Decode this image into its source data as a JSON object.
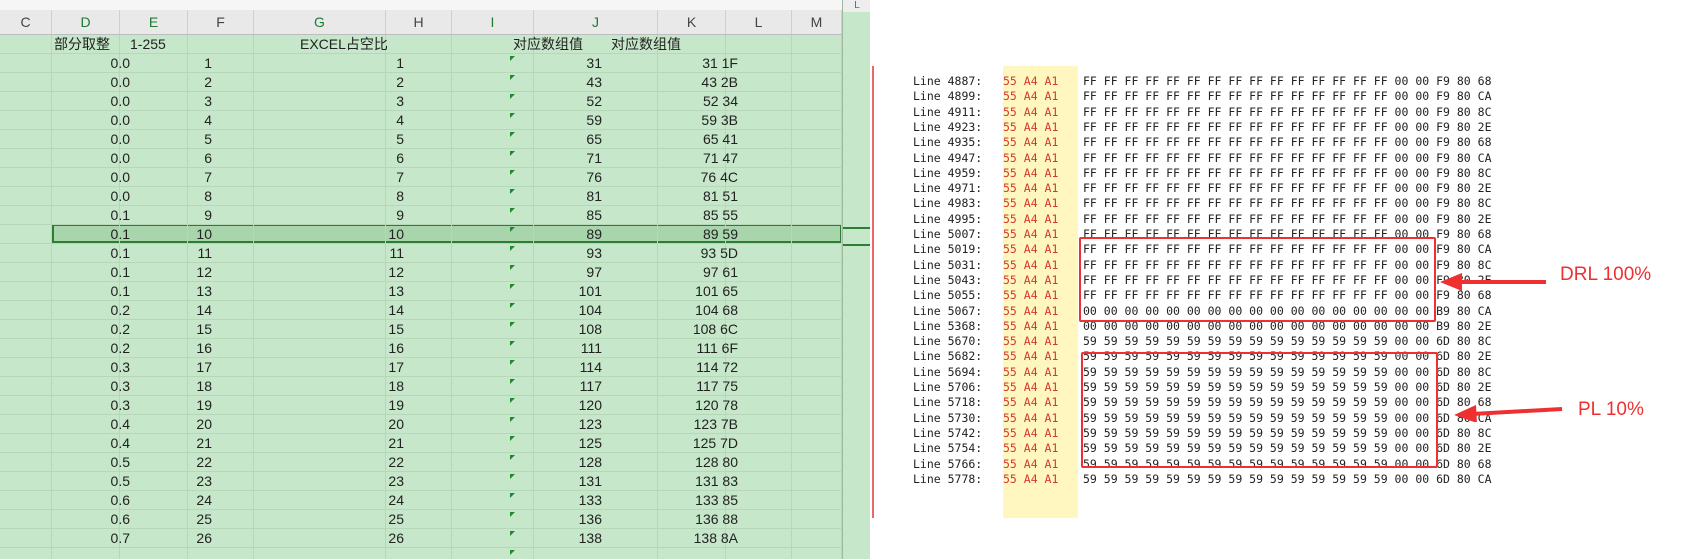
{
  "spreadsheet": {
    "column_headers": [
      "C",
      "D",
      "E",
      "F",
      "G",
      "H",
      "I",
      "J",
      "K",
      "L",
      "M"
    ],
    "side_header": "L",
    "headers": {
      "D": "部分取整",
      "E": "1-255",
      "G": "EXCEL占空比",
      "I": "对应数组值",
      "J": "对应数组值"
    },
    "rows": [
      {
        "d": "0.0",
        "e": "1",
        "g": "1",
        "i": "31",
        "j": "31 1F"
      },
      {
        "d": "0.0",
        "e": "2",
        "g": "2",
        "i": "43",
        "j": "43 2B"
      },
      {
        "d": "0.0",
        "e": "3",
        "g": "3",
        "i": "52",
        "j": "52 34"
      },
      {
        "d": "0.0",
        "e": "4",
        "g": "4",
        "i": "59",
        "j": "59 3B"
      },
      {
        "d": "0.0",
        "e": "5",
        "g": "5",
        "i": "65",
        "j": "65 41"
      },
      {
        "d": "0.0",
        "e": "6",
        "g": "6",
        "i": "71",
        "j": "71 47"
      },
      {
        "d": "0.0",
        "e": "7",
        "g": "7",
        "i": "76",
        "j": "76 4C"
      },
      {
        "d": "0.0",
        "e": "8",
        "g": "8",
        "i": "81",
        "j": "81 51"
      },
      {
        "d": "0.1",
        "e": "9",
        "g": "9",
        "i": "85",
        "j": "85 55"
      },
      {
        "d": "0.1",
        "e": "10",
        "g": "10",
        "i": "89",
        "j": "89 59"
      },
      {
        "d": "0.1",
        "e": "11",
        "g": "11",
        "i": "93",
        "j": "93 5D"
      },
      {
        "d": "0.1",
        "e": "12",
        "g": "12",
        "i": "97",
        "j": "97 61"
      },
      {
        "d": "0.1",
        "e": "13",
        "g": "13",
        "i": "101",
        "j": "101 65"
      },
      {
        "d": "0.2",
        "e": "14",
        "g": "14",
        "i": "104",
        "j": "104 68"
      },
      {
        "d": "0.2",
        "e": "15",
        "g": "15",
        "i": "108",
        "j": "108 6C"
      },
      {
        "d": "0.2",
        "e": "16",
        "g": "16",
        "i": "111",
        "j": "111 6F"
      },
      {
        "d": "0.3",
        "e": "17",
        "g": "17",
        "i": "114",
        "j": "114 72"
      },
      {
        "d": "0.3",
        "e": "18",
        "g": "18",
        "i": "117",
        "j": "117 75"
      },
      {
        "d": "0.3",
        "e": "19",
        "g": "19",
        "i": "120",
        "j": "120 78"
      },
      {
        "d": "0.4",
        "e": "20",
        "g": "20",
        "i": "123",
        "j": "123 7B"
      },
      {
        "d": "0.4",
        "e": "21",
        "g": "21",
        "i": "125",
        "j": "125 7D"
      },
      {
        "d": "0.5",
        "e": "22",
        "g": "22",
        "i": "128",
        "j": "128 80"
      },
      {
        "d": "0.5",
        "e": "23",
        "g": "23",
        "i": "131",
        "j": "131 83"
      },
      {
        "d": "0.6",
        "e": "24",
        "g": "24",
        "i": "133",
        "j": "133 85"
      },
      {
        "d": "0.6",
        "e": "25",
        "g": "25",
        "i": "136",
        "j": "136 88"
      },
      {
        "d": "0.7",
        "e": "26",
        "g": "26",
        "i": "138",
        "j": "138 8A"
      }
    ],
    "selected_row_index": 9
  },
  "hexlog": {
    "prefix": "55 A4 A1",
    "lines": [
      {
        "label": "Line 4887:",
        "bytes": "FF FF FF FF FF FF FF FF FF FF FF FF FF FF FF 00 00 F9 80 68"
      },
      {
        "label": "Line 4899:",
        "bytes": "FF FF FF FF FF FF FF FF FF FF FF FF FF FF FF 00 00 F9 80 CA"
      },
      {
        "label": "Line 4911:",
        "bytes": "FF FF FF FF FF FF FF FF FF FF FF FF FF FF FF 00 00 F9 80 8C"
      },
      {
        "label": "Line 4923:",
        "bytes": "FF FF FF FF FF FF FF FF FF FF FF FF FF FF FF 00 00 F9 80 2E"
      },
      {
        "label": "Line 4935:",
        "bytes": "FF FF FF FF FF FF FF FF FF FF FF FF FF FF FF 00 00 F9 80 68"
      },
      {
        "label": "Line 4947:",
        "bytes": "FF FF FF FF FF FF FF FF FF FF FF FF FF FF FF 00 00 F9 80 CA"
      },
      {
        "label": "Line 4959:",
        "bytes": "FF FF FF FF FF FF FF FF FF FF FF FF FF FF FF 00 00 F9 80 8C"
      },
      {
        "label": "Line 4971:",
        "bytes": "FF FF FF FF FF FF FF FF FF FF FF FF FF FF FF 00 00 F9 80 2E"
      },
      {
        "label": "Line 4983:",
        "bytes": "FF FF FF FF FF FF FF FF FF FF FF FF FF FF FF 00 00 F9 80 8C"
      },
      {
        "label": "Line 4995:",
        "bytes": "FF FF FF FF FF FF FF FF FF FF FF FF FF FF FF 00 00 F9 80 2E"
      },
      {
        "label": "Line 5007:",
        "bytes": "FF FF FF FF FF FF FF FF FF FF FF FF FF FF FF 00 00 F9 80 68"
      },
      {
        "label": "Line 5019:",
        "bytes": "FF FF FF FF FF FF FF FF FF FF FF FF FF FF FF 00 00 F9 80 CA"
      },
      {
        "label": "Line 5031:",
        "bytes": "FF FF FF FF FF FF FF FF FF FF FF FF FF FF FF 00 00 F9 80 8C"
      },
      {
        "label": "Line 5043:",
        "bytes": "FF FF FF FF FF FF FF FF FF FF FF FF FF FF FF 00 00 F9 80 2E"
      },
      {
        "label": "Line 5055:",
        "bytes": "FF FF FF FF FF FF FF FF FF FF FF FF FF FF FF 00 00 F9 80 68"
      },
      {
        "label": "Line 5067:",
        "bytes": "00 00 00 00 00 00 00 00 00 00 00 00 00 00 00 00 00 B9 80 CA"
      },
      {
        "label": "Line 5368:",
        "bytes": "00 00 00 00 00 00 00 00 00 00 00 00 00 00 00 00 00 B9 80 2E"
      },
      {
        "label": "Line 5670:",
        "bytes": "59 59 59 59 59 59 59 59 59 59 59 59 59 59 59 00 00 6D 80 8C"
      },
      {
        "label": "Line 5682:",
        "bytes": "59 59 59 59 59 59 59 59 59 59 59 59 59 59 59 00 00 6D 80 2E"
      },
      {
        "label": "Line 5694:",
        "bytes": "59 59 59 59 59 59 59 59 59 59 59 59 59 59 59 00 00 6D 80 8C"
      },
      {
        "label": "Line 5706:",
        "bytes": "59 59 59 59 59 59 59 59 59 59 59 59 59 59 59 00 00 6D 80 2E"
      },
      {
        "label": "Line 5718:",
        "bytes": "59 59 59 59 59 59 59 59 59 59 59 59 59 59 59 00 00 6D 80 68"
      },
      {
        "label": "Line 5730:",
        "bytes": "59 59 59 59 59 59 59 59 59 59 59 59 59 59 59 00 00 6D 80 CA"
      },
      {
        "label": "Line 5742:",
        "bytes": "59 59 59 59 59 59 59 59 59 59 59 59 59 59 59 00 00 6D 80 8C"
      },
      {
        "label": "Line 5754:",
        "bytes": "59 59 59 59 59 59 59 59 59 59 59 59 59 59 59 00 00 6D 80 2E"
      },
      {
        "label": "Line 5766:",
        "bytes": "59 59 59 59 59 59 59 59 59 59 59 59 59 59 59 00 00 6D 80 68"
      },
      {
        "label": "Line 5778:",
        "bytes": "59 59 59 59 59 59 59 59 59 59 59 59 59 59 59 00 00 6D 80 CA"
      }
    ],
    "annotations": [
      {
        "label": "DRL 100%"
      },
      {
        "label": "PL  10%"
      }
    ],
    "colors": {
      "annotation": "#ee3030",
      "prefix_text": "#d33a2c",
      "prefix_highlight": "#fff7bf",
      "sheet_bg": "#c6e7c9",
      "selection": "#2d7d32"
    }
  }
}
